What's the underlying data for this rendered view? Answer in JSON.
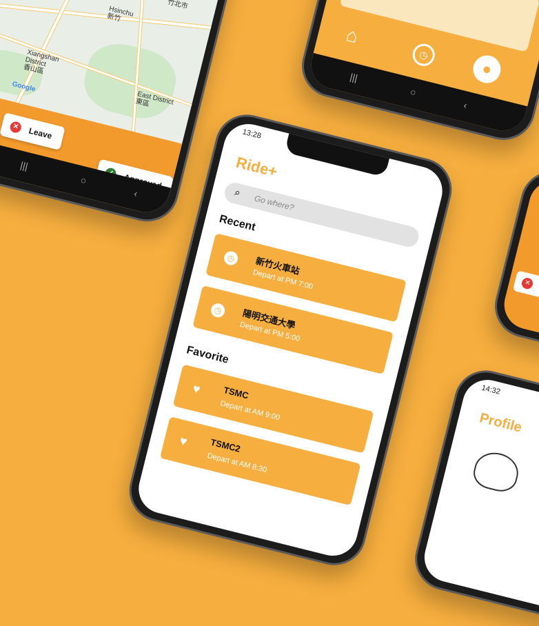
{
  "colors": {
    "background": "#F6AE3E",
    "accent": "#F6AE3E",
    "leave": "#E53935",
    "approved": "#2E7D32"
  },
  "map_phone": {
    "labels": [
      "Hsinchu\n新竹",
      "Xiangshan\nDistrict\n香山區",
      "East District\n東區",
      "竹北市",
      "新竹",
      "Google"
    ],
    "leave_label": "Leave",
    "approved_label": "Approved"
  },
  "main_phone": {
    "status_time": "13:28",
    "app_title": "Ride+",
    "search_placeholder": "Go where?",
    "recent_title": "Recent",
    "recent": [
      {
        "title": "新竹火車站",
        "subtitle": "Depart at PM 7:00",
        "icon": "clock-icon"
      },
      {
        "title": "陽明交通大學",
        "subtitle": "Depart at PM 5:00",
        "icon": "clock-icon"
      }
    ],
    "favorite_title": "Favorite",
    "favorite": [
      {
        "title": "TSMC",
        "subtitle": "Depart at AM 9:00",
        "icon": "heart-icon"
      },
      {
        "title": "TSMC2",
        "subtitle": "Depart at AM 8:30",
        "icon": "heart-icon"
      }
    ]
  },
  "profile_phone": {
    "status_time": "14:32",
    "title": "Profile"
  }
}
